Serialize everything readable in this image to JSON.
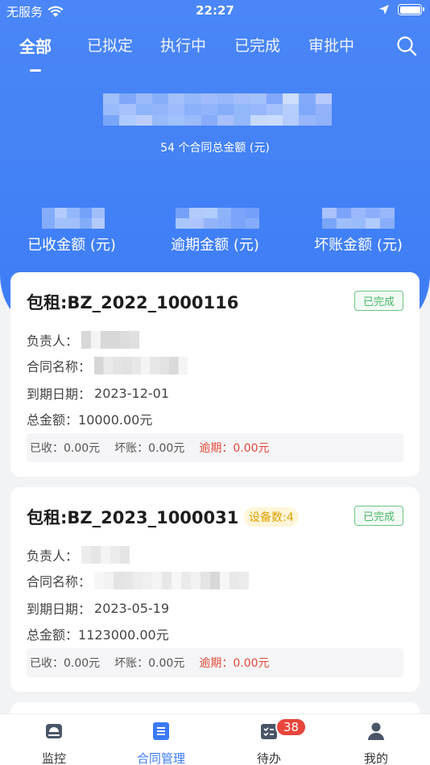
{
  "status_bar": {
    "carrier": "无服务",
    "time": "22:27"
  },
  "tabs": [
    {
      "label": "全部",
      "active": true
    },
    {
      "label": "已拟定",
      "active": false
    },
    {
      "label": "执行中",
      "active": false
    },
    {
      "label": "已完成",
      "active": false
    },
    {
      "label": "审批中",
      "active": false
    }
  ],
  "summary": {
    "total_caption": "54 个合同总金额 (元)",
    "stats": [
      {
        "label": "已收金额 (元)"
      },
      {
        "label": "逾期金额 (元)"
      },
      {
        "label": "坏账金额 (元)"
      }
    ]
  },
  "contracts": [
    {
      "title": "包租:BZ_2022_1000116",
      "status": "已完成",
      "device_count": "",
      "owner_label": "负责人：",
      "name_label": "合同名称：",
      "due_label": "到期日期：",
      "due_date": "2023-12-01",
      "total_label": "总金额：",
      "total": "10000.00元",
      "received": "已收：0.00元",
      "bad_debt": "坏账：0.00元",
      "overdue": "逾期：0.00元"
    },
    {
      "title": "包租:BZ_2023_1000031",
      "status": "已完成",
      "device_count": "设备数:4",
      "owner_label": "负责人：",
      "name_label": "合同名称：",
      "due_label": "到期日期：",
      "due_date": "2023-05-19",
      "total_label": "总金额：",
      "total": "1123000.00元",
      "received": "已收：0.00元",
      "bad_debt": "坏账：0.00元",
      "overdue": "逾期：0.00元"
    }
  ],
  "bottom_nav": [
    {
      "label": "监控",
      "icon": "monitor-icon",
      "active": false
    },
    {
      "label": "合同管理",
      "icon": "contract-icon",
      "active": true
    },
    {
      "label": "待办",
      "icon": "todo-icon",
      "active": false,
      "badge": "38"
    },
    {
      "label": "我的",
      "icon": "user-icon",
      "active": false
    }
  ],
  "colors": {
    "primary": "#3d7df5",
    "success": "#4cb86a",
    "danger": "#e04a3a",
    "warning": "#e0a100"
  }
}
